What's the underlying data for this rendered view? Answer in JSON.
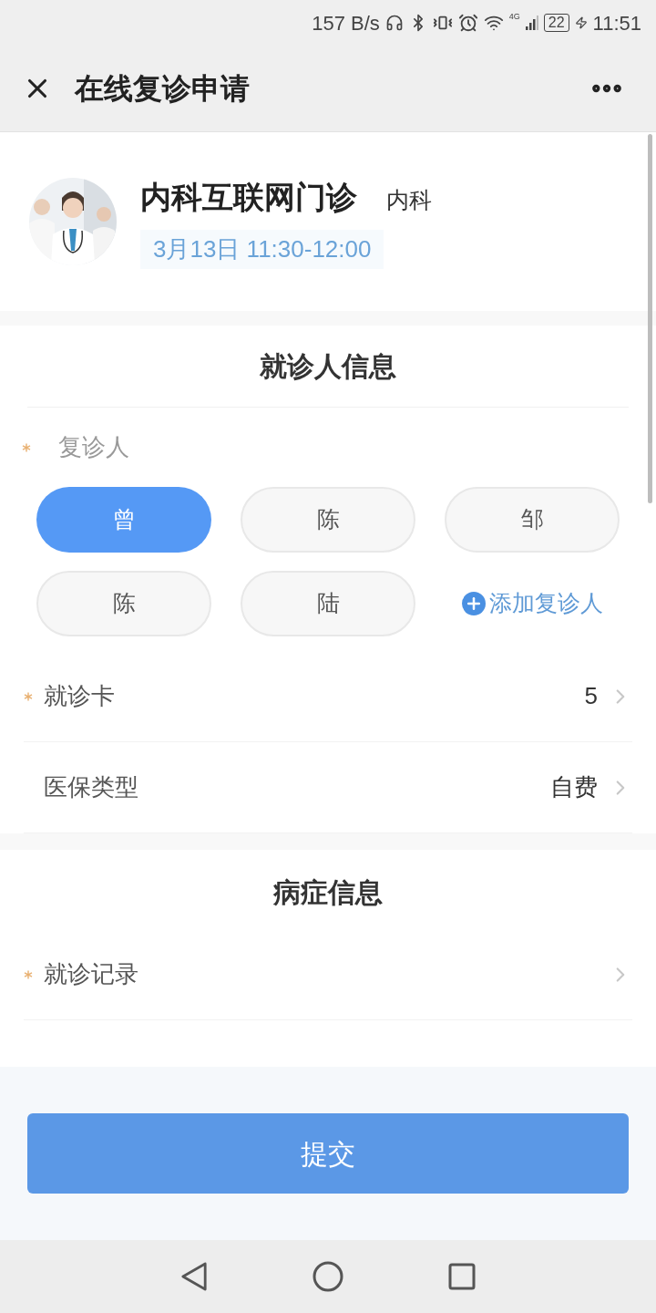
{
  "status_bar": {
    "speed": "157 B/s",
    "network": "4G",
    "battery": "22",
    "time": "11:51"
  },
  "header": {
    "title": "在线复诊申请"
  },
  "clinic": {
    "name": "内科互联网门诊",
    "department": "内科",
    "time": "3月13日 11:30-12:00"
  },
  "patient_section": {
    "title": "就诊人信息",
    "field_label": "复诊人",
    "required": true,
    "patients": [
      {
        "name": "曾",
        "selected": true
      },
      {
        "name": "陈",
        "selected": false
      },
      {
        "name": "邹",
        "selected": false
      },
      {
        "name": "陈",
        "selected": false
      },
      {
        "name": "陆",
        "selected": false
      }
    ],
    "add_label": "添加复诊人",
    "rows": [
      {
        "label": "就诊卡",
        "required": true,
        "value": "5"
      },
      {
        "label": "医保类型",
        "required": false,
        "value": "自费"
      }
    ]
  },
  "illness_section": {
    "title": "病症信息",
    "rows": [
      {
        "label": "就诊记录",
        "required": true,
        "value": ""
      }
    ]
  },
  "submit": {
    "label": "提交"
  }
}
